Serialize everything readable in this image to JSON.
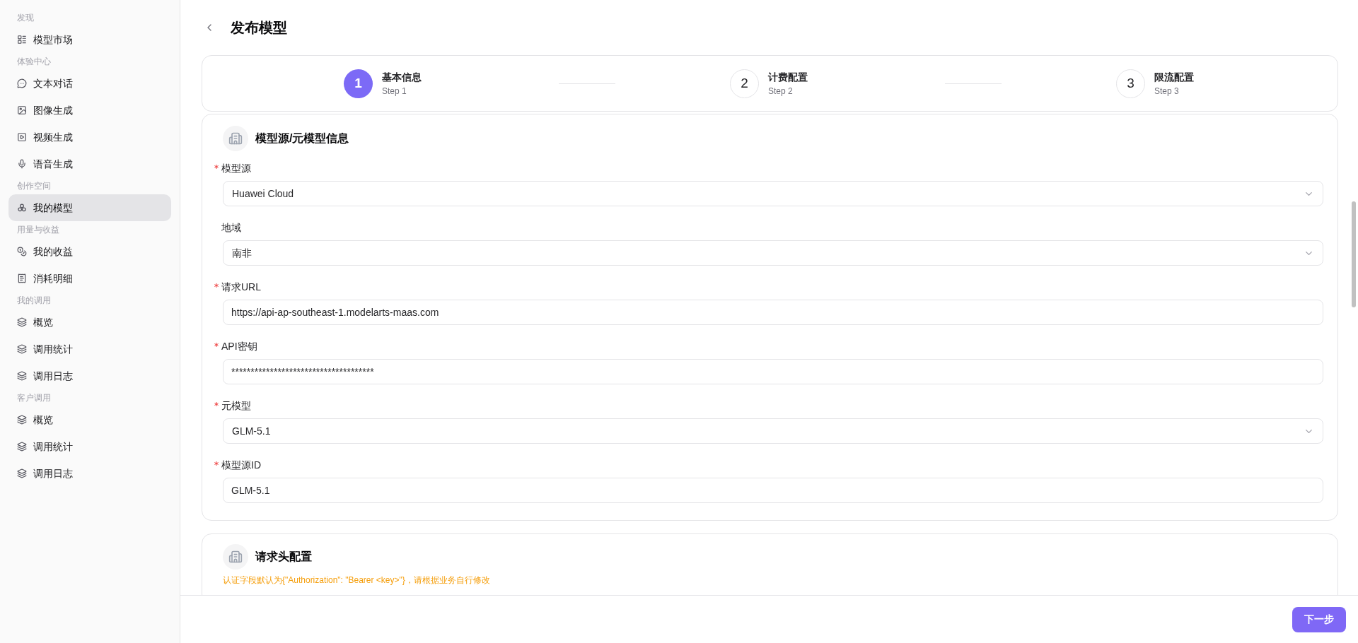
{
  "sidebar": {
    "sections": [
      {
        "title": "发现",
        "items": [
          {
            "label": "模型市场",
            "selected": false
          }
        ]
      },
      {
        "title": "体验中心",
        "items": [
          {
            "label": "文本对话",
            "selected": false
          },
          {
            "label": "图像生成",
            "selected": false
          },
          {
            "label": "视频生成",
            "selected": false
          },
          {
            "label": "语音生成",
            "selected": false
          }
        ]
      },
      {
        "title": "创作空间",
        "items": [
          {
            "label": "我的模型",
            "selected": true
          }
        ]
      },
      {
        "title": "用量与收益",
        "items": [
          {
            "label": "我的收益",
            "selected": false
          },
          {
            "label": "消耗明细",
            "selected": false
          }
        ]
      },
      {
        "title": "我的调用",
        "items": [
          {
            "label": "概览",
            "selected": false
          },
          {
            "label": "调用统计",
            "selected": false
          },
          {
            "label": "调用日志",
            "selected": false
          }
        ]
      },
      {
        "title": "客户调用",
        "items": [
          {
            "label": "概览",
            "selected": false
          },
          {
            "label": "调用统计",
            "selected": false
          },
          {
            "label": "调用日志",
            "selected": false
          }
        ]
      }
    ]
  },
  "page_title": "发布模型",
  "steps": [
    {
      "number": "1",
      "title": "基本信息",
      "subtitle": "Step 1",
      "selected": true
    },
    {
      "number": "2",
      "title": "计费配置",
      "subtitle": "Step 2",
      "selected": false
    },
    {
      "number": "3",
      "title": "限流配置",
      "subtitle": "Step 3",
      "selected": false
    }
  ],
  "source_card": {
    "title": "模型源/元模型信息",
    "fields": [
      {
        "label": "模型源",
        "required": true,
        "kind": "select",
        "value": "Huawei Cloud"
      },
      {
        "label": "地域",
        "required": false,
        "kind": "select",
        "value": "南非"
      },
      {
        "label": "请求URL",
        "required": true,
        "kind": "input",
        "value": "https://api-ap-southeast-1.modelarts-maas.com"
      },
      {
        "label": "API密钥",
        "required": true,
        "kind": "input",
        "value": "*************************************"
      },
      {
        "label": "元模型",
        "required": true,
        "kind": "select",
        "value": "GLM-5.1"
      },
      {
        "label": "模型源ID",
        "required": true,
        "kind": "input",
        "value": "GLM-5.1"
      }
    ]
  },
  "header_card": {
    "title": "请求头配置",
    "note": "认证字段默认为{\"Authorization\": \"Bearer <key>\"}，请根据业务自行修改"
  },
  "footer": {
    "next_button": "下一步"
  }
}
